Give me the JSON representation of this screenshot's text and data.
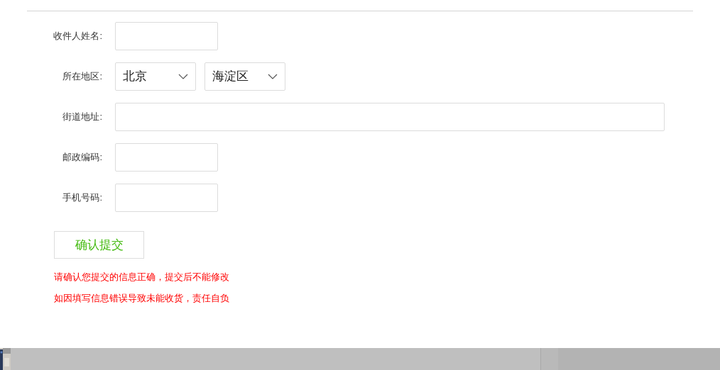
{
  "form": {
    "fields": [
      {
        "kind": "short_text",
        "label": "收件人姓名:"
      },
      {
        "kind": "selects",
        "label": "所在地区:",
        "selects": [
          {
            "value": "北京"
          },
          {
            "value": "海淀区"
          }
        ]
      },
      {
        "kind": "long_text",
        "label": "街道地址:"
      },
      {
        "kind": "short_text",
        "label": "邮政编码:"
      },
      {
        "kind": "short_text",
        "label": "手机号码:"
      }
    ]
  },
  "submit_button": "确认提交",
  "notices": [
    "请确认您提交的信息正确，提交后不能修改",
    "如因填写信息错误导致未能收货，责任自负"
  ]
}
